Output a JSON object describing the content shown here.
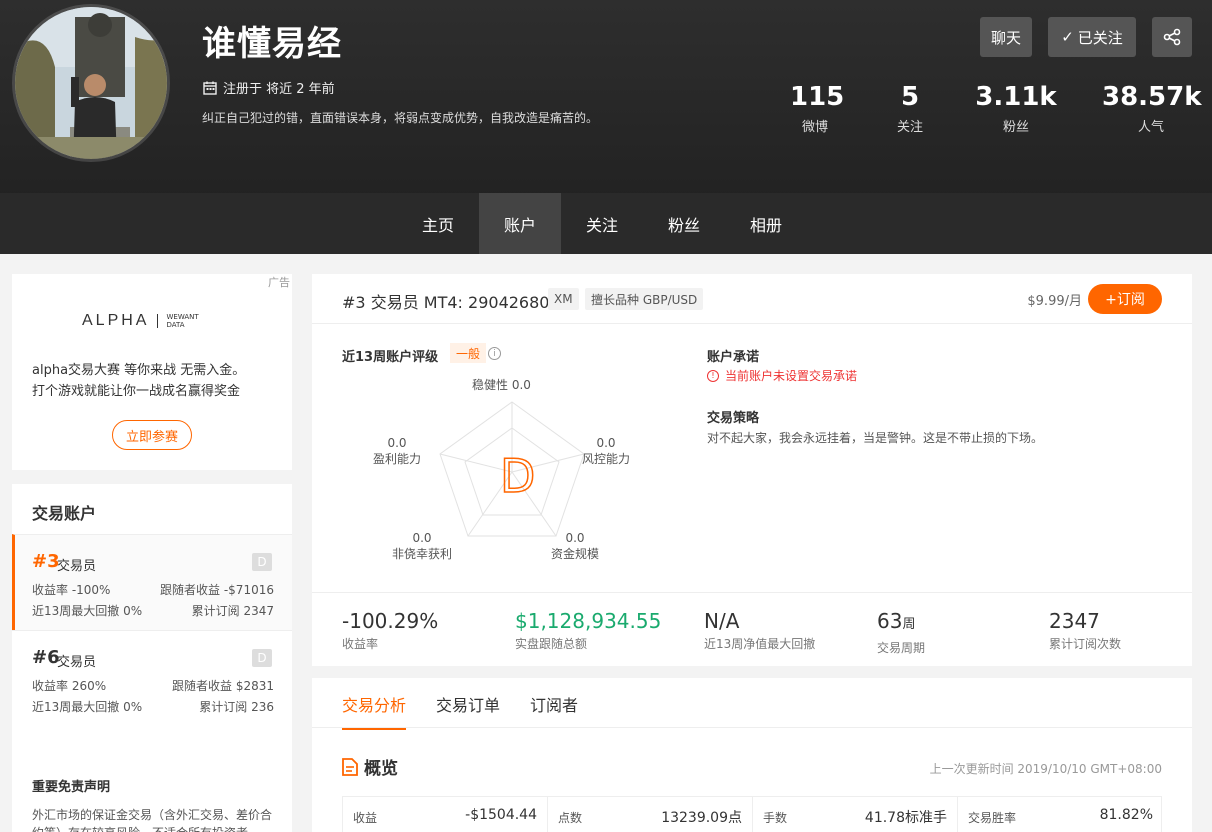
{
  "profile": {
    "name": "谁懂易经",
    "registered": "注册于 将近 2 年前",
    "bio": "纠正自己犯过的错，直面错误本身，将弱点变成优势，自我改造是痛苦的。"
  },
  "header_buttons": {
    "chat": "聊天",
    "followed": "已关注"
  },
  "stats": [
    {
      "value": "115",
      "label": "微博"
    },
    {
      "value": "5",
      "label": "关注"
    },
    {
      "value": "3.11k",
      "label": "粉丝"
    },
    {
      "value": "38.57k",
      "label": "人气"
    }
  ],
  "nav": [
    "主页",
    "账户",
    "关注",
    "粉丝",
    "相册"
  ],
  "ad": {
    "tag": "广告",
    "logo": "ALPHA",
    "logo_sub1": "WEWANT",
    "logo_sub2": "DATA",
    "line1": "alpha交易大赛 等你来战 无需入金。",
    "line2": "打个游戏就能让你一战成名赢得奖金",
    "button": "立即参赛"
  },
  "accounts": {
    "title": "交易账户",
    "items": [
      {
        "rank": "#3",
        "role": "交易员",
        "grade": "D",
        "yield": "收益率 -100%",
        "follower_profit": "跟随者收益 -$71016",
        "drawdown": "近13周最大回撤 0%",
        "subs": "累计订阅 2347"
      },
      {
        "rank": "#6",
        "role": "交易员",
        "grade": "D",
        "yield": "收益率 260%",
        "follower_profit": "跟随者收益 $2831",
        "drawdown": "近13周最大回撤 0%",
        "subs": "累计订阅 236"
      }
    ]
  },
  "disclaimer": {
    "title": "重要免责声明",
    "text": "外汇市场的保证金交易（含外汇交易、差价合约等）存在较高风险，不适合所有投资者"
  },
  "account": {
    "rank": "#3",
    "role": "交易员",
    "mt4": "MT4: 29042680",
    "broker": "XM",
    "specialty": "擅长品种 GBP/USD",
    "price": "$9.99/月",
    "subscribe": "+订阅"
  },
  "rating": {
    "title": "近13周账户评级",
    "level": "一般",
    "grade": "D",
    "axes": [
      {
        "name": "稳健性",
        "value": "0.0"
      },
      {
        "name": "风控能力",
        "value": "0.0"
      },
      {
        "name": "资金规模",
        "value": "0.0"
      },
      {
        "name": "非侥幸获利",
        "value": "0.0"
      },
      {
        "name": "盈利能力",
        "value": "0.0"
      }
    ]
  },
  "commitment": {
    "title": "账户承诺",
    "warning": "当前账户未设置交易承诺"
  },
  "strategy": {
    "title": "交易策略",
    "text": "对不起大家，我会永远挂着，当是警钟。这是不带止损的下场。"
  },
  "metrics": [
    {
      "value": "-100.29%",
      "unit": "",
      "label": "收益率",
      "color": "#333333"
    },
    {
      "value": "$1,128,934.55",
      "unit": "",
      "label": "实盘跟随总额",
      "color": "#1aaa6e"
    },
    {
      "value": "N/A",
      "unit": "",
      "label": "近13周净值最大回撤",
      "color": "#333333"
    },
    {
      "value": "63",
      "unit": "周",
      "label": "交易周期",
      "color": "#333333"
    },
    {
      "value": "2347",
      "unit": "",
      "label": "累计订阅次数",
      "color": "#333333"
    }
  ],
  "tabs": [
    "交易分析",
    "交易订单",
    "订阅者"
  ],
  "overview": {
    "title": "概览",
    "updated": "上一次更新时间 2019/10/10 GMT+08:00",
    "cells": [
      {
        "key": "收益",
        "value": "-$1504.44"
      },
      {
        "key": "点数",
        "value": "13239.09点"
      },
      {
        "key": "手数",
        "value": "41.78标准手"
      },
      {
        "key": "交易胜率",
        "value": "81.82%"
      }
    ]
  },
  "colors": {
    "accent": "#ff6600",
    "header_bg": "#262626",
    "positive": "#1aaa6e",
    "warning": "#e33333"
  }
}
